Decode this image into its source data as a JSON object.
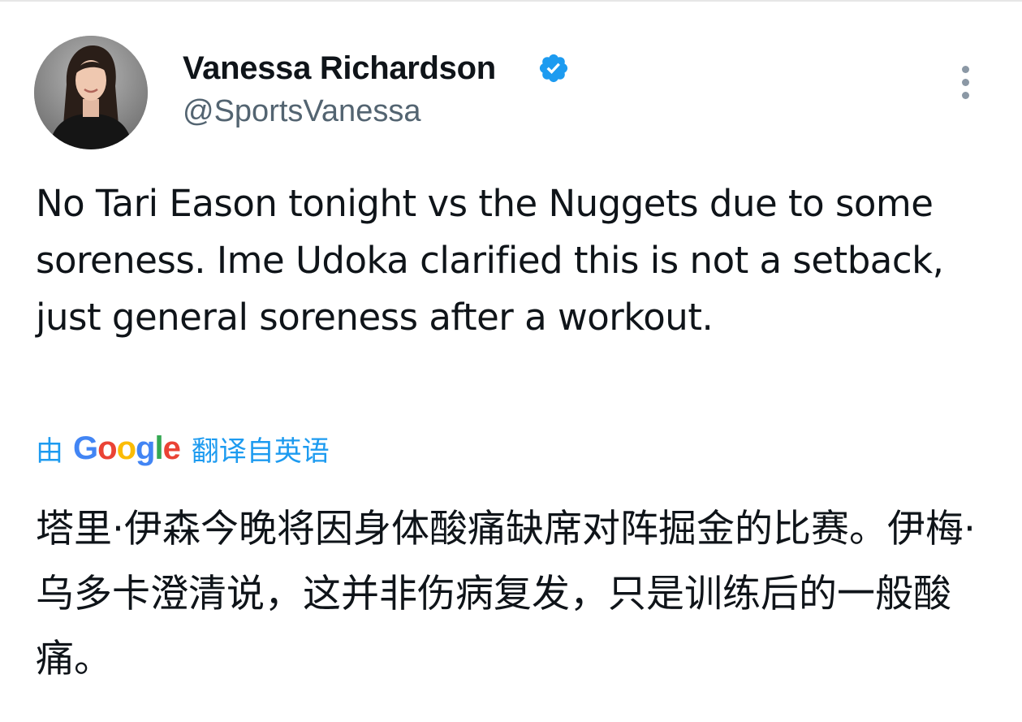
{
  "author": {
    "display_name": "Vanessa Richardson",
    "handle": "@SportsVanessa",
    "verified": true
  },
  "tweet": {
    "text": "No Tari Eason tonight vs the Nuggets due to some soreness. Ime Udoka clarified this is not a setback, just general soreness after a workout."
  },
  "translation": {
    "by_label": "由",
    "provider_letters": [
      "G",
      "o",
      "o",
      "g",
      "l",
      "e"
    ],
    "provider_colors": [
      "#4285F4",
      "#EA4335",
      "#FBBC05",
      "#4285F4",
      "#34A853",
      "#EA4335"
    ],
    "suffix_label": "翻译自英语",
    "translated_text": "塔里·伊森今晚将因身体酸痛缺席对阵掘金的比赛。伊梅·乌多卡澄清说，这并非伤病复发，只是训练后的一般酸痛。"
  },
  "icons": {
    "verified": "verified-badge-icon",
    "more": "more-vertical-icon"
  },
  "colors": {
    "text_primary": "#0f1419",
    "text_secondary": "#536471",
    "accent_blue": "#1d9bf0"
  }
}
